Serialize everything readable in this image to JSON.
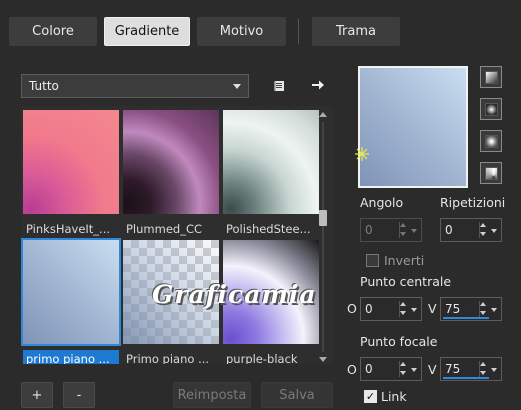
{
  "tabs": [
    {
      "label": "Colore"
    },
    {
      "label": "Gradiente"
    },
    {
      "label": "Motivo"
    },
    {
      "label": "Trama"
    }
  ],
  "category_dropdown": {
    "value": "Tutto"
  },
  "gradients": [
    {
      "caption": "PinksHaveIt_..."
    },
    {
      "caption": "Plummed_CC"
    },
    {
      "caption": "PolishedStee..."
    },
    {
      "caption": "primo piano ..."
    },
    {
      "caption": "Primo piano ..."
    },
    {
      "caption": "purple-black"
    }
  ],
  "watermark": "Graficamia",
  "buttons": {
    "add": "+",
    "remove": "-",
    "reset": "Reimposta",
    "save": "Salva"
  },
  "angle": {
    "label": "Angolo",
    "value": "0"
  },
  "repeats": {
    "label": "Ripetizioni",
    "value": "0"
  },
  "invert": {
    "label": "Inverti"
  },
  "center_point": {
    "label": "Punto centrale",
    "h_label": "O",
    "h_value": "0",
    "v_label": "V",
    "v_value": "75"
  },
  "focal_point": {
    "label": "Punto focale",
    "h_label": "O",
    "h_value": "0",
    "v_label": "V",
    "v_value": "75"
  },
  "link": {
    "label": "Link"
  },
  "colors": {
    "accent": "#2f88d8",
    "background": "#2b2b2b",
    "preview_start": "#7f93b7",
    "preview_end": "#c9def1"
  },
  "icons": [
    "library-icon",
    "arrow-right-icon",
    "linear-gradient-icon",
    "radial-gradient-icon",
    "rectangular-gradient-icon",
    "sunburst-gradient-icon",
    "focal-point-icon"
  ]
}
